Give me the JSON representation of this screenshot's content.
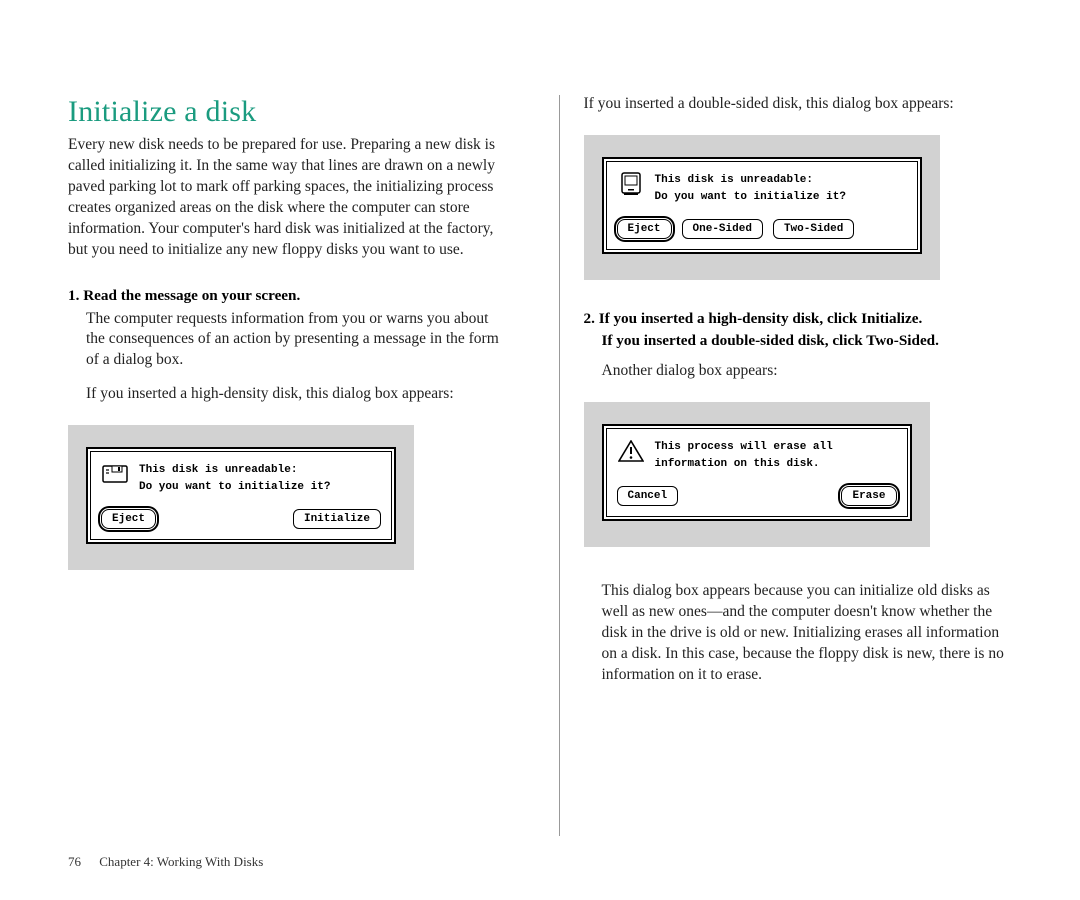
{
  "title": "Initialize a disk",
  "intro": "Every new disk needs to be prepared for use. Preparing a new disk is called initializing it. In the same way that lines are drawn on a newly paved parking lot to mark off parking spaces, the initializing process creates organized areas on the disk where the computer can store information. Your computer's hard disk was initialized at the factory, but you need to initialize any new floppy disks you want to use.",
  "steps": {
    "s1": {
      "head": "1.  Read the message on your screen.",
      "body": "The computer requests information from you or warns you about the consequences of an action by presenting a message in the form of a dialog box.",
      "lead_hd": "If you inserted a high-density disk, this dialog box appears:",
      "lead_ds": "If you inserted a double-sided disk, this dialog box appears:"
    },
    "s2": {
      "head_a": "2.  If you inserted a high-density disk, click Initialize.",
      "head_b": "If you inserted a double-sided disk, click Two-Sided.",
      "lead": "Another dialog box appears:",
      "after": "This dialog box appears because you can initialize old disks as well as new ones—and the computer doesn't know whether the disk in the drive is old or new. Initializing erases all information on a disk. In this case, because the floppy disk is new, there is no information on it to erase."
    }
  },
  "dlg1": {
    "l1": "This disk is unreadable:",
    "l2": "Do you want to initialize it?",
    "eject": "Eject",
    "init": "Initialize"
  },
  "dlg2": {
    "l1": "This disk is unreadable:",
    "l2": "Do you want to initialize it?",
    "eject": "Eject",
    "one": "One-Sided",
    "two": "Two-Sided"
  },
  "dlg3": {
    "l1": "This process will erase all",
    "l2": "information on this disk.",
    "cancel": "Cancel",
    "erase": "Erase"
  },
  "footer": {
    "page": "76",
    "chapter": "Chapter 4: Working With Disks"
  }
}
